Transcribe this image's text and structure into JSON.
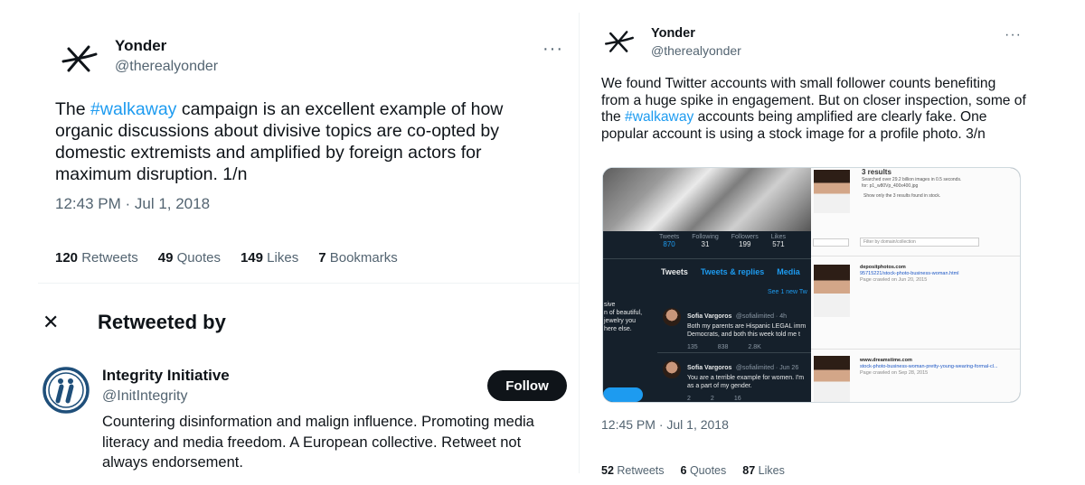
{
  "left_tweet": {
    "author_name": "Yonder",
    "author_handle": "@therealyonder",
    "more_label": "···",
    "text_before": "The ",
    "hashtag": "#walkaway",
    "text_after": " campaign is an excellent example of how organic discussions about divisive topics are co-opted by domestic extremists and amplified by foreign actors for maximum disruption. 1/n",
    "timestamp": "12:43 PM · Jul 1, 2018",
    "stats": [
      {
        "count": "120",
        "label": "Retweets"
      },
      {
        "count": "49",
        "label": "Quotes"
      },
      {
        "count": "149",
        "label": "Likes"
      },
      {
        "count": "7",
        "label": "Bookmarks"
      }
    ]
  },
  "retweeted_by": {
    "close_label": "✕",
    "title": "Retweeted by",
    "user": {
      "name": "Integrity Initiative",
      "handle": "@InitIntegrity",
      "follow_label": "Follow",
      "bio": "Countering disinformation and malign influence. Promoting media literacy and media freedom. A European collective. Retweet not always endorsement."
    }
  },
  "right_tweet": {
    "author_name": "Yonder",
    "author_handle": "@therealyonder",
    "more_label": "···",
    "text_before": "We found Twitter accounts with small follower counts benefiting from a huge spike in engagement. But on closer inspection, some of the ",
    "hashtag": "#walkaway",
    "text_after": " accounts being amplified are clearly fake. One popular account is using a stock image for a profile photo. 3/n",
    "timestamp": "12:45 PM · Jul 1, 2018",
    "stats": [
      {
        "count": "52",
        "label": "Retweets"
      },
      {
        "count": "6",
        "label": "Quotes"
      },
      {
        "count": "87",
        "label": "Likes"
      }
    ],
    "media": {
      "profile_stats": [
        {
          "label": "Tweets",
          "value": "870"
        },
        {
          "label": "Following",
          "value": "31"
        },
        {
          "label": "Followers",
          "value": "199"
        },
        {
          "label": "Likes",
          "value": "571"
        }
      ],
      "tabs": [
        "Tweets",
        "Tweets & replies",
        "Media"
      ],
      "see_new": "See 1 new Tw",
      "bio_snippet": "sive\nn of beautiful,\njewelry you\nhere else.",
      "tweets": [
        {
          "name": "Sofia Vargoros",
          "handle": "@sofialimited · 4h",
          "text": "Both my parents are Hispanic LEGAL imm\nDemocrats, and both this week told me t",
          "actions": [
            "135",
            "838",
            "2.8K"
          ]
        },
        {
          "name": "Sofia Vargoros",
          "handle": "@sofialimited · Jun 26",
          "text": "You are a terrible example for women. I'm\nas a part of my gender.",
          "actions": [
            "2",
            "2",
            "16"
          ]
        }
      ],
      "results_heading": "3 results",
      "results_info": "Searched over 29.2 billion images in 0.5 seconds.",
      "results_file": "for: p1_w80Vp_400x400.jpg",
      "results_filter_note": "Show only the 3 results found in stock.",
      "filter_placeholder": "Filter by domain/collection",
      "results": [
        {
          "site": "depositphotos.com",
          "url": "95715221/stock-photo-business-woman.html",
          "crawled": "Page crawled on Jun 20, 2015"
        },
        {
          "site": "www.dreamstime.com",
          "url": "stock-photo-business-woman-pretty-young-wearing-formal-cl...",
          "crawled": "Page crawled on Sep 28, 2015"
        }
      ]
    }
  }
}
